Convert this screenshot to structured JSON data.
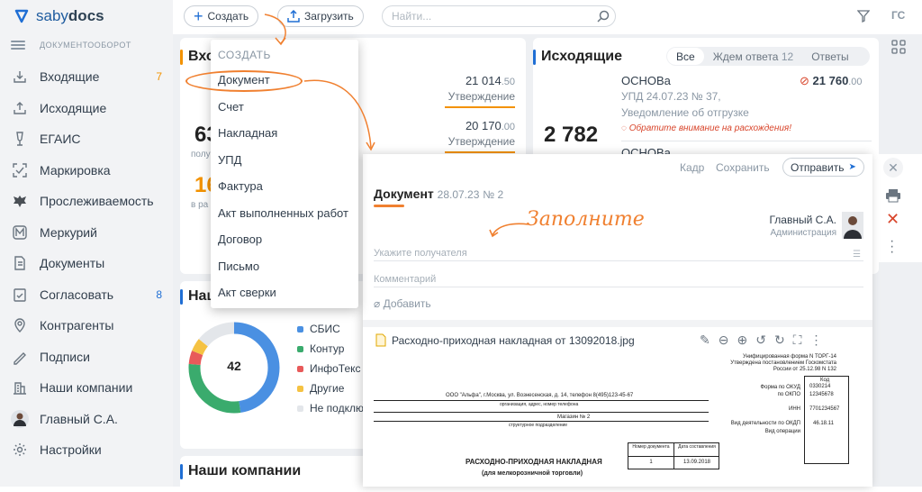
{
  "app": {
    "logo_saby": "saby",
    "logo_docs": "docs",
    "section_label": "ДОКУМЕНТООБОРОТ"
  },
  "sidebar": {
    "items": [
      {
        "label": "Входящие",
        "count": "7",
        "icon": "inbox-icon"
      },
      {
        "label": "Исходящие",
        "count": "",
        "icon": "outbox-icon"
      },
      {
        "label": "ЕГАИС",
        "count": "",
        "icon": "glass-icon"
      },
      {
        "label": "Маркировка",
        "count": "",
        "icon": "scan-icon"
      },
      {
        "label": "Прослеживаемость",
        "count": "",
        "icon": "eagle-icon"
      },
      {
        "label": "Меркурий",
        "count": "",
        "icon": "m-badge-icon"
      },
      {
        "label": "Документы",
        "count": "",
        "icon": "documents-icon"
      },
      {
        "label": "Согласовать",
        "count": "8",
        "icon": "approve-icon"
      },
      {
        "label": "Контрагенты",
        "count": "",
        "icon": "contractors-icon"
      },
      {
        "label": "Подписи",
        "count": "",
        "icon": "signature-icon"
      },
      {
        "label": "Наши компании",
        "count": "",
        "icon": "buildings-icon"
      },
      {
        "label": "Главный С.А.",
        "count": "",
        "icon": "avatar"
      },
      {
        "label": "Настройки",
        "count": "",
        "icon": "gear-icon"
      }
    ]
  },
  "toolbar": {
    "create_label": "Создать",
    "upload_label": "Загрузить",
    "search_placeholder": "Найти...",
    "user_initials": "ГС"
  },
  "incoming": {
    "title": "Вхо",
    "big_number": "63",
    "sub_label": "полу",
    "orange_number": "16",
    "sub_label2": "в ра",
    "rows": [
      {
        "amount": "21 014",
        "cents": ".50",
        "status": "Утверждение"
      },
      {
        "amount": "20 170",
        "cents": ".00",
        "status": "Утверждение"
      }
    ]
  },
  "outgoing": {
    "title": "Исходящие",
    "tabs": [
      "Все",
      "Ждем ответа",
      "Ответы"
    ],
    "waiting_count": "12",
    "total": "2 782",
    "item": {
      "company": "ОСНОВа",
      "amount": "21 760",
      "cents": ".00",
      "doc": "УПД 24.07.23 № 37,",
      "desc": "Уведомление об отгрузке",
      "warning": "Обратите внимание на расхождения!"
    },
    "next_company": "ОСНОВа"
  },
  "ours": {
    "title": "Наш",
    "donut_total": "42",
    "legend": [
      "СБИС",
      "Контур",
      "ИнфоТекс",
      "Другие",
      "Не подклю"
    ],
    "colors": [
      "#4a90e2",
      "#3aab6d",
      "#e85a5a",
      "#f5c242",
      "#e3e6ea"
    ],
    "values": [
      20,
      12,
      2,
      2,
      6
    ]
  },
  "companies": {
    "title": "Наши компании"
  },
  "create_menu": {
    "header": "СОЗДАТЬ",
    "items": [
      "Документ",
      "Счет",
      "Накладная",
      "УПД",
      "Фактура",
      "Акт выполненных работ",
      "Договор",
      "Письмо",
      "Акт сверки"
    ]
  },
  "document": {
    "top_actions": {
      "frame": "Кадр",
      "save": "Сохранить",
      "send": "Отправить"
    },
    "title": "Документ",
    "date": "28.07.23",
    "number": "№ 2",
    "hint": "Заполните",
    "author_name": "Главный С.А.",
    "author_role": "Администрация",
    "recipient_placeholder": "Укажите получателя",
    "comment_placeholder": "Комментарий",
    "add_label": "Добавить",
    "attachment_name": "Расходно-приходная накладная от 13092018.jpg",
    "scan": {
      "form_title": "Унифицированная форма N ТОРГ-14",
      "form_sub": "Утверждена постановлением Госкомстата",
      "form_sub2": "России от 25.12.98 N 132",
      "code_label": "Код",
      "okud_label": "Форма по ОКУД",
      "okud": "0330214",
      "okpo_label": "по ОКПО",
      "okpo": "12345678",
      "org": "ООО \"Альфа\", г.Москва, ул. Вознесенская, д. 14, телефон 8(495)123-45-67",
      "org_hint": "организация, адрес, номер телефона",
      "inn_label": "ИНН",
      "inn": "7701234567",
      "shop": "Магазин № 2",
      "div_hint": "структурное подразделение",
      "okdp_label": "Вид деятельности по ОКДП",
      "okdp": "46.18.11",
      "op_label": "Вид операции",
      "num_head": "Номер документа",
      "date_head": "Дата составления",
      "doc_num": "1",
      "doc_date": "13.09.2018",
      "big_title": "РАСХОДНО-ПРИХОДНАЯ НАКЛАДНАЯ",
      "big_sub": "(для мелкорозничной торговли)"
    }
  }
}
